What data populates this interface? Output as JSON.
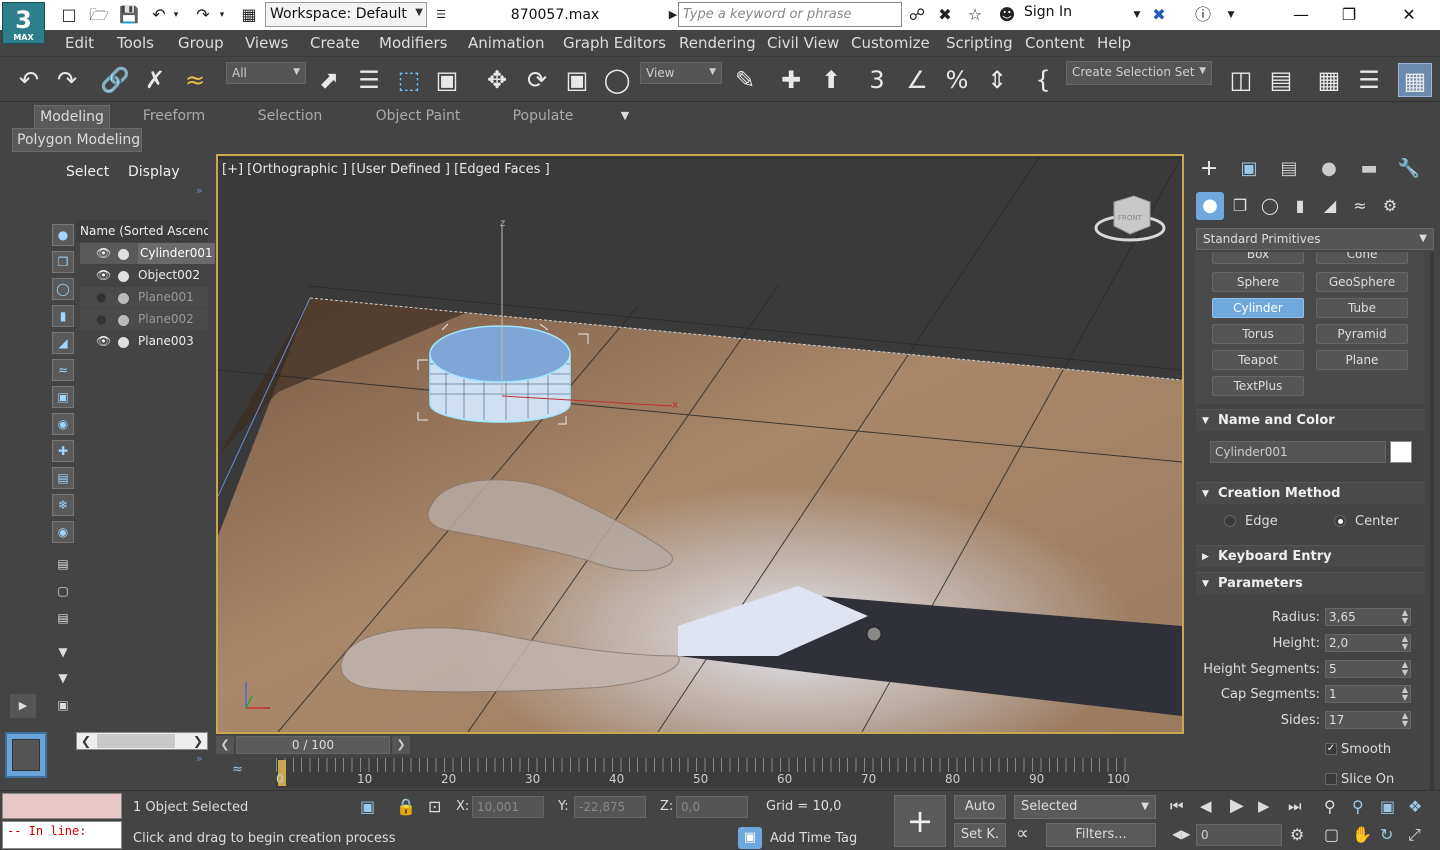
{
  "app": {
    "logo": "3",
    "logo_sub": "MAX"
  },
  "titlebar": {
    "workspace": "Workspace: Default",
    "filename": "870057.max",
    "search_placeholder": "Type a keyword or phrase",
    "signin": "Sign In"
  },
  "menu": [
    "Edit",
    "Tools",
    "Group",
    "Views",
    "Create",
    "Modifiers",
    "Animation",
    "Graph Editors",
    "Rendering",
    "Civil View",
    "Customize",
    "Scripting",
    "Content",
    "Help"
  ],
  "toolbar": {
    "filter": "All",
    "view": "View",
    "selection_set": "Create Selection Set"
  },
  "ribbon": {
    "tabs": [
      "Modeling",
      "Freeform",
      "Selection",
      "Object Paint",
      "Populate"
    ],
    "subtab": "Polygon Modeling"
  },
  "scene": {
    "tabs": [
      "Select",
      "Display"
    ],
    "header": "Name (Sorted Ascendi",
    "items": [
      {
        "name": "Cylinder001",
        "visible": true,
        "selected": true
      },
      {
        "name": "Object002",
        "visible": true,
        "selected": false
      },
      {
        "name": "Plane001",
        "visible": false,
        "selected": false
      },
      {
        "name": "Plane002",
        "visible": false,
        "selected": false
      },
      {
        "name": "Plane003",
        "visible": true,
        "selected": false
      }
    ]
  },
  "viewport": {
    "label": "[+] [Orthographic ] [User Defined ] [Edged Faces ]",
    "viewcube_label": "FRONT",
    "axis_x": "x",
    "axis_z": "z"
  },
  "timeline": {
    "frame": "0 / 100",
    "ticks": [
      "0",
      "10",
      "20",
      "30",
      "40",
      "50",
      "60",
      "70",
      "80",
      "90",
      "100"
    ]
  },
  "command_panel": {
    "category": "Standard Primitives",
    "primitives": [
      "Box",
      "Cone",
      "Sphere",
      "GeoSphere",
      "Cylinder",
      "Tube",
      "Torus",
      "Pyramid",
      "Teapot",
      "Plane",
      "TextPlus"
    ],
    "active_primitive": "Cylinder",
    "rollouts": {
      "name_color": "Name and Color",
      "creation_method": "Creation Method",
      "keyboard_entry": "Keyboard Entry",
      "parameters": "Parameters"
    },
    "object_name": "Cylinder001",
    "creation_options": [
      "Edge",
      "Center"
    ],
    "parameters": [
      {
        "label": "Radius:",
        "value": "3,65"
      },
      {
        "label": "Height:",
        "value": "2,0"
      },
      {
        "label": "Height Segments:",
        "value": "5"
      },
      {
        "label": "Cap Segments:",
        "value": "1"
      },
      {
        "label": "Sides:",
        "value": "17"
      }
    ],
    "smooth": "Smooth",
    "slice_on": "Slice On"
  },
  "status": {
    "maxscript_prompt": "-- In line:",
    "selected": "1 Object Selected",
    "prompt": "Click and drag to begin creation process",
    "x_label": "X:",
    "x": "10,001",
    "y_label": "Y:",
    "y": "-22,875",
    "z_label": "Z:",
    "z": "0,0",
    "grid": "Grid = 10,0",
    "add_time_tag": "Add Time Tag",
    "auto": "Auto",
    "set_key": "Set K.",
    "key_filter": "Selected",
    "filters": "Filters...",
    "frame_field": "0"
  },
  "colors": {
    "accent": "#6fa8dc",
    "viewport_border": "#c8a74e",
    "logo": "#2c7f8a"
  }
}
